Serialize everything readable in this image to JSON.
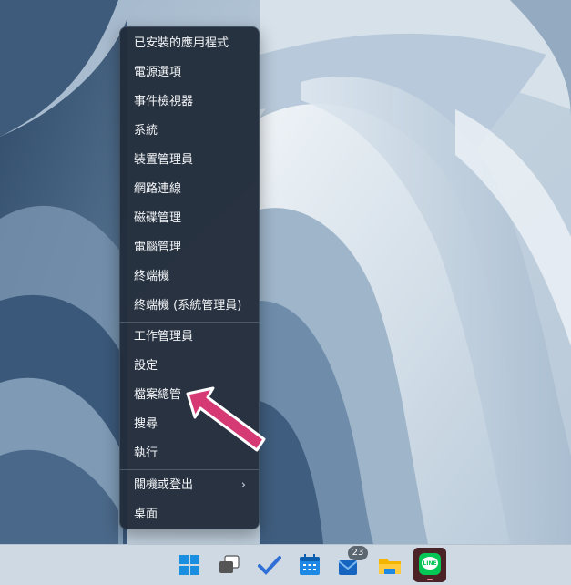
{
  "context_menu": {
    "items": [
      {
        "label": "已安裝的應用程式"
      },
      {
        "label": "電源選項"
      },
      {
        "label": "事件檢視器"
      },
      {
        "label": "系統"
      },
      {
        "label": "裝置管理員"
      },
      {
        "label": "網路連線"
      },
      {
        "label": "磁碟管理"
      },
      {
        "label": "電腦管理"
      },
      {
        "label": "終端機"
      },
      {
        "label": "終端機 (系統管理員)"
      },
      {
        "label": "工作管理員"
      },
      {
        "label": "設定"
      },
      {
        "label": "檔案總管"
      },
      {
        "label": "搜尋"
      },
      {
        "label": "執行"
      },
      {
        "label": "關機或登出",
        "has_submenu": true
      },
      {
        "label": "桌面"
      }
    ],
    "submenu_chevron": "›"
  },
  "annotation": {
    "color": "#d63a75",
    "points_to": "檔案總管"
  },
  "taskbar": {
    "apps": [
      {
        "name": "start",
        "icon": "windows-logo-icon"
      },
      {
        "name": "task-view",
        "icon": "task-view-icon"
      },
      {
        "name": "todo",
        "icon": "checkmark-icon"
      },
      {
        "name": "calendar",
        "icon": "calendar-icon"
      },
      {
        "name": "mail",
        "icon": "mail-icon",
        "badge": "23"
      },
      {
        "name": "file-explorer",
        "icon": "folder-icon"
      },
      {
        "name": "line",
        "icon": "line-app-icon",
        "label": "LINE"
      }
    ]
  }
}
